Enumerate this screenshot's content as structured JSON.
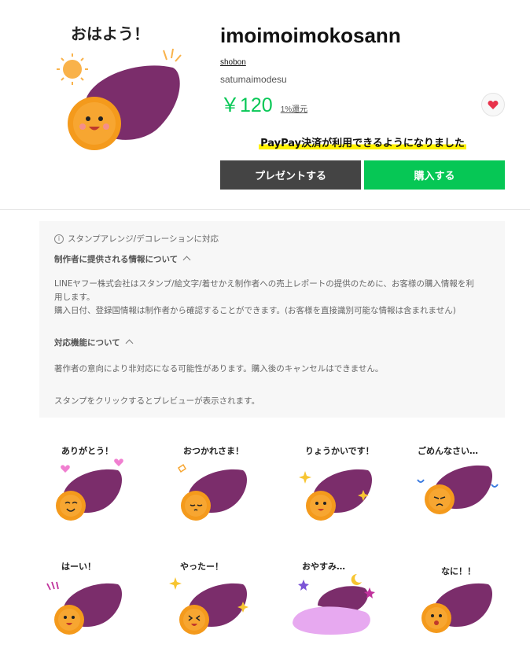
{
  "product": {
    "title": "imoimoimokosann",
    "author": "shobon",
    "subtitle": "satumaimodesu",
    "price": "￥120",
    "reward": "1%還元",
    "hero_caption": "おはよう！",
    "notice": "PayPay決済が利用できるようになりました"
  },
  "actions": {
    "gift_label": "プレゼントする",
    "buy_label": "購入する"
  },
  "panel": {
    "support": "スタンプアレンジ/デコレーションに対応",
    "info_heading": "制作者に提供される情報について",
    "info_body_1": "LINEヤフー株式会社はスタンプ/絵文字/着せかえ制作者への売上レポートの提供のために、お客様の購入情報を利",
    "info_body_2": "用します。",
    "info_body_3": "購入日付、登録国情報は制作者から確認することができます。(お客様を直接識別可能な情報は含まれません)",
    "feature_heading": "対応機能について",
    "feature_body": "著作者の意向により非対応になる可能性があります。購入後のキャンセルはできません。",
    "preview_hint": "スタンプをクリックするとプレビューが表示されます。"
  },
  "stickers": [
    {
      "caption": "ありがとう！"
    },
    {
      "caption": "おつかれさま！"
    },
    {
      "caption": "りょうかいです！"
    },
    {
      "caption": "ごめんなさい…"
    },
    {
      "caption": "はーい！"
    },
    {
      "caption": "やったー！"
    },
    {
      "caption": "おやすみ…"
    },
    {
      "caption": "なに！！"
    }
  ],
  "colors": {
    "accent": "#06c755",
    "gift_button": "#444444",
    "potato": "#7b2d6b",
    "flesh": "#f7a631",
    "heart": "#e8324b",
    "highlight": "#fff200"
  }
}
